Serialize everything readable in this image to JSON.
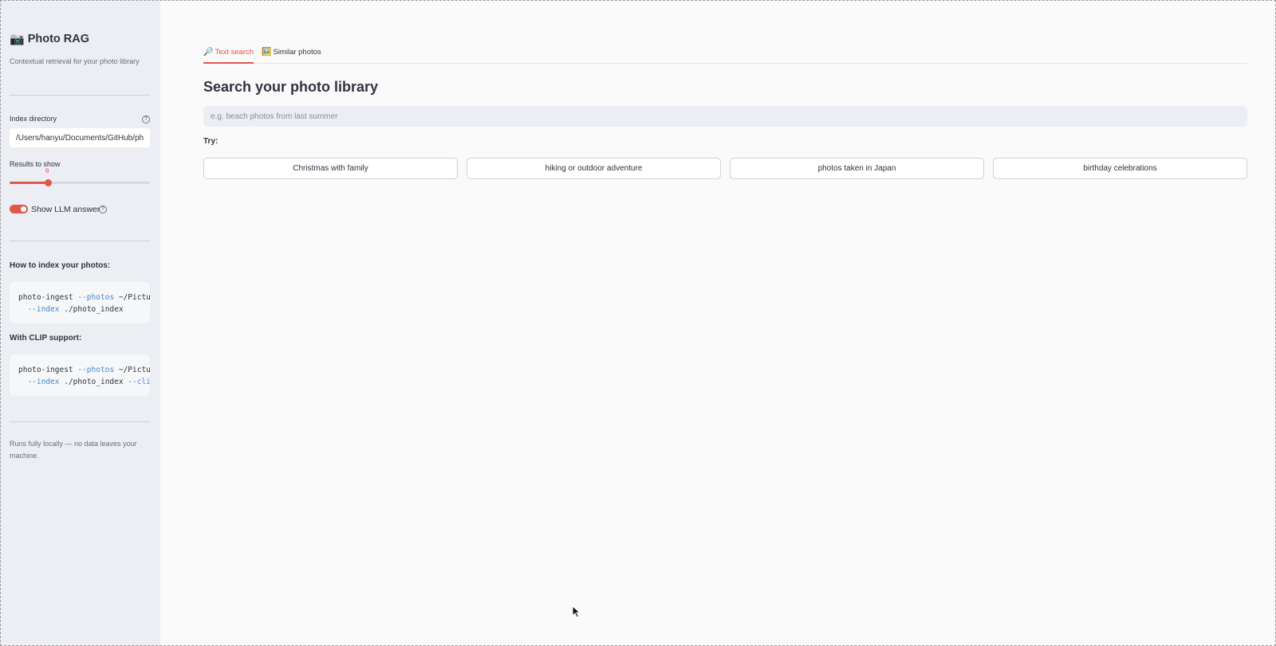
{
  "sidebar": {
    "title": "Photo RAG",
    "title_icon": "camera-icon",
    "subtitle": "Contextual retrieval for your photo library",
    "index_directory": {
      "label": "Index directory",
      "value": "/Users/hanyu/Documents/GitHub/photo_index"
    },
    "results": {
      "label": "Results to show",
      "value": "6",
      "fraction": 0.27
    },
    "llm_toggle": {
      "label": "Show LLM answer",
      "on": true
    },
    "how_to_heading": "How to index your photos:",
    "code1": {
      "cmd": "photo-ingest ",
      "flag1": "--photos",
      "arg1": " ~/Pictures",
      "flag2": "--index",
      "arg2": " ./photo_index"
    },
    "clip_heading": "With CLIP support:",
    "code2": {
      "cmd": "photo-ingest ",
      "flag1": "--photos",
      "arg1": " ~/Pictures",
      "flag2": "--index",
      "arg2": " ./photo_index ",
      "flag3": "--clip"
    },
    "footer": "Runs fully locally — no data leaves your machine."
  },
  "tabs": [
    {
      "label": "Text search",
      "icon": "magnifier-icon",
      "active": true
    },
    {
      "label": "Similar photos",
      "icon": "picture-icon",
      "active": false
    }
  ],
  "main": {
    "title": "Search your photo library",
    "search_placeholder": "e.g. beach photos from last summer",
    "try_label": "Try:",
    "suggestions": [
      "Christmas with family",
      "hiking or outdoor adventure",
      "photos taken in Japan",
      "birthday celebrations"
    ]
  },
  "colors": {
    "accent": "#e0584a",
    "sidebar_bg": "#eceef3",
    "main_bg": "#fafafa"
  }
}
